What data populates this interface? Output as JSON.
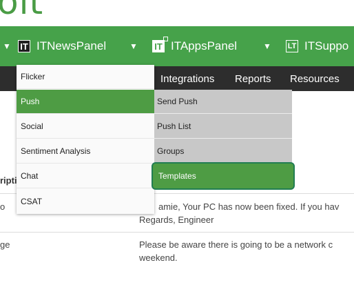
{
  "brand": {
    "text": "oit"
  },
  "topnav": {
    "items": [
      {
        "label": "ITNewsPanel",
        "logo": "IT"
      },
      {
        "label": "ITAppsPanel",
        "logo": "IT"
      },
      {
        "label": "ITSuppo",
        "logo": "LT"
      }
    ]
  },
  "subnav": {
    "items": [
      {
        "label": "Integrations"
      },
      {
        "label": "Reports"
      },
      {
        "label": "Resources"
      }
    ]
  },
  "content": {
    "header_fragment": "ripti",
    "rows": [
      {
        "left": "o",
        "message": "amie, Your PC has now been fixed. If you hav",
        "message2": "Regards, Engineer"
      },
      {
        "left": "ge",
        "message": "Please be aware there is going to be a network c",
        "message2": "weekend."
      }
    ]
  },
  "menu": {
    "items": [
      {
        "label": "Flicker"
      },
      {
        "label": "Push"
      },
      {
        "label": "Social"
      },
      {
        "label": "Sentiment Analysis"
      },
      {
        "label": "Chat"
      },
      {
        "label": "CSAT"
      }
    ],
    "active_index": 1
  },
  "submenu": {
    "items": [
      {
        "label": "Send Push"
      },
      {
        "label": "Push List"
      },
      {
        "label": "Groups"
      },
      {
        "label": "Templates"
      }
    ],
    "highlight_index": 3
  },
  "colors": {
    "brand_green": "#46a24a",
    "subnav_dark": "#2d2d2d",
    "menu_active": "#4e9c44",
    "highlight_border": "#217d52"
  }
}
